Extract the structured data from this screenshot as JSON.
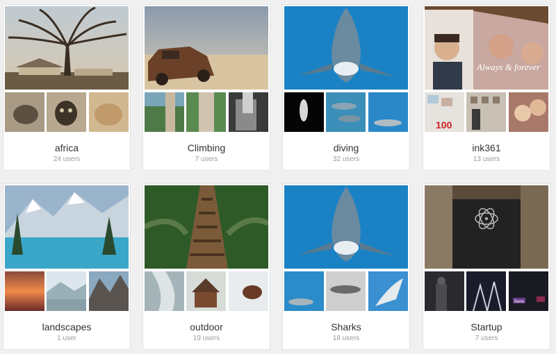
{
  "groups": [
    {
      "name": "africa",
      "users": "24 users"
    },
    {
      "name": "Climbing",
      "users": "7 users"
    },
    {
      "name": "diving",
      "users": "32 users"
    },
    {
      "name": "ink361",
      "users": "13 users"
    },
    {
      "name": "landscapes",
      "users": "1 user"
    },
    {
      "name": "outdoor",
      "users": "19 users"
    },
    {
      "name": "Sharks",
      "users": "18 users"
    },
    {
      "name": "Startup",
      "users": "7 users"
    }
  ],
  "overlays": {
    "ink361_caption": "Always & forever",
    "ink361_emoji": "100",
    "startup_badge": "Bane"
  }
}
